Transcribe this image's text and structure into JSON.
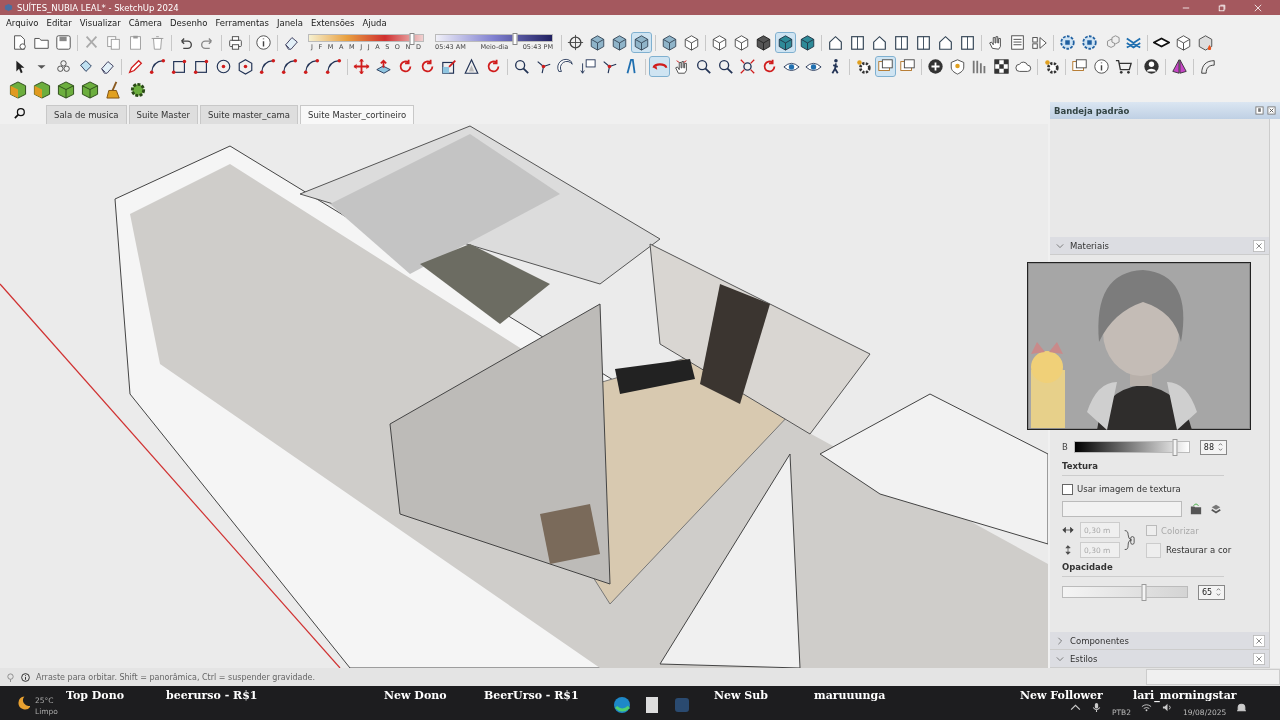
{
  "window": {
    "title": "SUÍTES_NUBIA LEAL* - SketchUp 2024"
  },
  "menu": [
    "Arquivo",
    "Editar",
    "Visualizar",
    "Câmera",
    "Desenho",
    "Ferramentas",
    "Janela",
    "Extensões",
    "Ajuda"
  ],
  "shadow_settings": {
    "months": [
      "J",
      "F",
      "M",
      "A",
      "M",
      "J",
      "J",
      "A",
      "S",
      "O",
      "N",
      "D"
    ],
    "month_slider": {
      "level": 0.9
    },
    "time_labels": [
      "05:43 AM",
      "Meio-dia",
      "05:43 PM"
    ],
    "time_slider": {
      "level": 0.68
    }
  },
  "scene_tabs": [
    {
      "label": "Sala de musica",
      "selected": false
    },
    {
      "label": "Suite Master",
      "selected": false
    },
    {
      "label": "Suite master_cama",
      "selected": false
    },
    {
      "label": "Suite Master_cortineiro",
      "selected": true
    }
  ],
  "tray": {
    "title": "Bandeja padrão",
    "panels": [
      {
        "title": "Materiais",
        "expanded": true
      },
      {
        "title": "Componentes",
        "expanded": false
      },
      {
        "title": "Estilos",
        "expanded": true
      }
    ]
  },
  "materials": {
    "brightness": {
      "label": "B",
      "level": 0.88,
      "value": "88"
    },
    "texture_heading": "Textura",
    "use_texture": {
      "label": "Usar imagem de textura",
      "checked": false
    },
    "texture_width": "0,30 m",
    "texture_height": "0,30 m",
    "colorize": {
      "label": "Colorizar",
      "checked": false,
      "disabled": true
    },
    "reset_color": "Restaurar a cor",
    "opacity_heading": "Opacidade",
    "opacity": {
      "level": 0.65,
      "value": "65"
    }
  },
  "status_bar": {
    "hint": "Arraste para orbitar. Shift = panorâmica, Ctrl = suspender gravidade."
  },
  "taskbar": {
    "temperature": "25°C",
    "weather": "Limpo",
    "language": "PTB2",
    "date": "19/08/2025"
  },
  "stream_ticker": [
    {
      "label": "Top Dono",
      "value": "beerurso - R$1"
    },
    {
      "label": "New Dono",
      "value": "BeerUrso - R$1"
    },
    {
      "label": "New Sub",
      "value": "maruuunga"
    },
    {
      "label": "New Follower",
      "value": "lari_morningstar"
    }
  ]
}
